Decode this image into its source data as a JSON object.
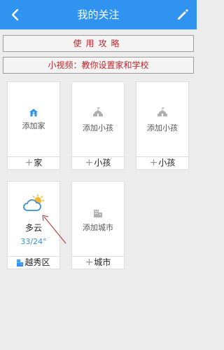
{
  "header": {
    "title": "我的关注"
  },
  "banners": {
    "guide": "使用攻略",
    "video": "小视频：教你设置家和学校"
  },
  "cards": [
    {
      "label": "添加家",
      "footer": "家",
      "footer_icon": "plus-icon"
    },
    {
      "label": "添加小孩",
      "footer": "小孩",
      "footer_icon": "plus-icon"
    },
    {
      "label": "添加小孩",
      "footer": "小孩",
      "footer_icon": "plus-icon"
    },
    {
      "weather": "多云",
      "temp": "33/24°",
      "footer": "越秀区",
      "footer_icon": "building-icon"
    },
    {
      "label": "添加城市",
      "footer": "城市",
      "footer_icon": "plus-icon"
    }
  ],
  "colors": {
    "header_bg": "#2f93ef",
    "banner_text": "#c3242b",
    "temp_text": "#3a8fd8"
  }
}
